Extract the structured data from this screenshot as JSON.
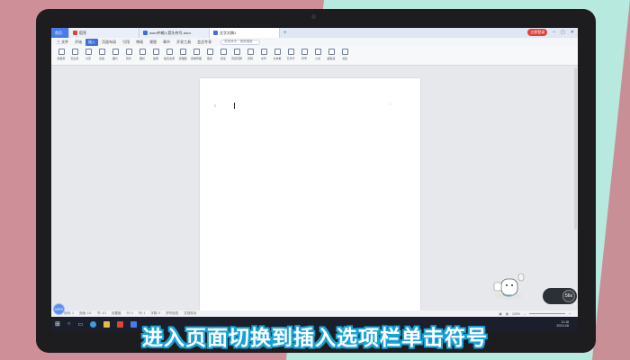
{
  "tabs": {
    "home": "首页",
    "docer": "稻壳",
    "doc1": "word中输入箭头符号.docx",
    "doc2": "文字文稿1",
    "add": "+"
  },
  "window": {
    "login": "立即登录"
  },
  "menu": {
    "items": [
      "三 文件",
      "开始",
      "插入",
      "页面布局",
      "引用",
      "审阅",
      "视图",
      "章节",
      "开发工具",
      "会员专享"
    ],
    "active_index": 2,
    "search_placeholder": "查找命令、搜索模板"
  },
  "ribbon": {
    "tools": [
      "封面页",
      "空白页",
      "分页",
      "表格",
      "图片",
      "形状",
      "图标",
      "截屏",
      "稻壳资源",
      "流程图",
      "思维导图",
      "更多",
      "批注",
      "页眉页脚",
      "页码",
      "水印",
      "文本框",
      "艺术字",
      "符号",
      "公式",
      "超链接",
      "书签"
    ]
  },
  "statusbar": {
    "page": "页码: 1",
    "pages": "页面: 1/1",
    "section": "节: 1/1",
    "setting": "设置值",
    "row": "行: 1",
    "col": "列: 1",
    "words": "字数: 0",
    "spell": "拼写检查",
    "doc_check": "文档校对",
    "zoom": "100%"
  },
  "taskbar": {
    "time": "11:18",
    "date": "2021/1/8"
  },
  "badges": {
    "wps_logo": "WPS",
    "speed": "56x"
  },
  "subtitle": "进入页面切换到插入选项栏单击符号",
  "colors": {
    "accent": "#3f6fdc",
    "subtitle_stroke": "#17a2d8",
    "bg_pink": "#cf8f98",
    "bg_mint": "#b8e9de"
  }
}
